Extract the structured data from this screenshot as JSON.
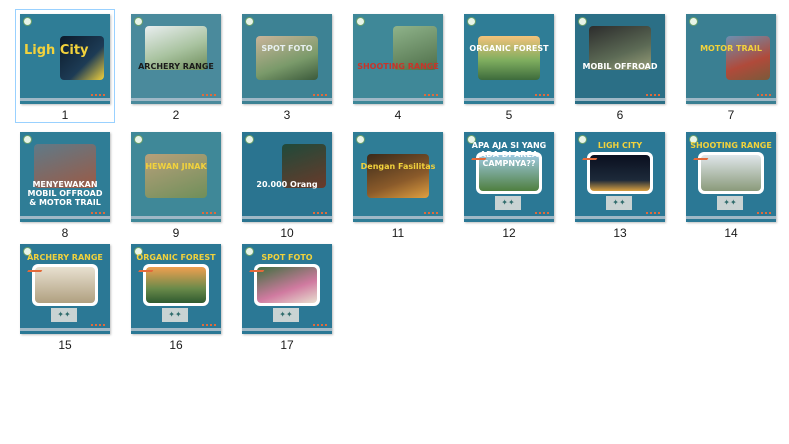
{
  "selected_index": 0,
  "items": [
    {
      "label": "1",
      "title": "Ligh City",
      "theme": "#2f7d96"
    },
    {
      "label": "2",
      "title": "ARCHERY RANGE",
      "theme": "#4a8a9c"
    },
    {
      "label": "3",
      "title": "SPOT FOTO",
      "theme": "#3d8294"
    },
    {
      "label": "4",
      "title": "SHOOTING RANGE",
      "theme": "#3f8898"
    },
    {
      "label": "5",
      "title": "ORGANIC FOREST",
      "theme": "#2f7d96"
    },
    {
      "label": "6",
      "title": "MOBIL OFFROAD",
      "theme": "#2b6f86"
    },
    {
      "label": "7",
      "title": "MOTOR TRAIL",
      "theme": "#3a7f92"
    },
    {
      "label": "8",
      "title": "MENYEWAKAN MOBIL OFFROAD & MOTOR TRAIL",
      "theme": "#2f7d96"
    },
    {
      "label": "9",
      "title": "HEWAN JINAK",
      "theme": "#3f8898"
    },
    {
      "label": "10",
      "title": "20.000 Orang",
      "theme": "#2a7490"
    },
    {
      "label": "11",
      "title": "Dengan Fasilitas",
      "theme": "#2f7d96"
    },
    {
      "label": "12",
      "title": "APA AJA SI YANG ADA DI AREA CAMPNYA??",
      "theme": "#2b7895"
    },
    {
      "label": "13",
      "title": "LIGH CITY",
      "theme": "#2b7895"
    },
    {
      "label": "14",
      "title": "SHOOTING RANGE",
      "theme": "#2b7895"
    },
    {
      "label": "15",
      "title": "ARCHERY RANGE",
      "theme": "#2b7895"
    },
    {
      "label": "16",
      "title": "ORGANIC FOREST",
      "theme": "#2b7895"
    },
    {
      "label": "17",
      "title": "SPOT FOTO",
      "theme": "#2b7895"
    }
  ]
}
